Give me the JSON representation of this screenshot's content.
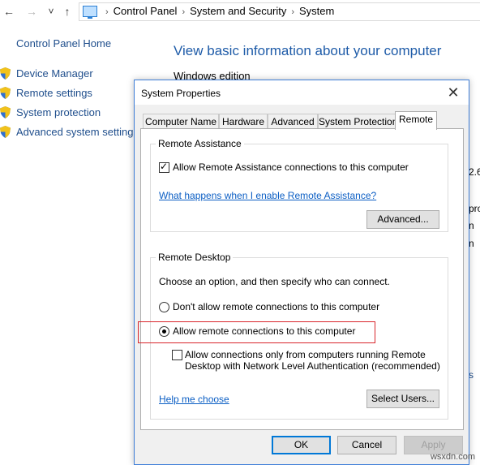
{
  "addressbar": {
    "back_glyph": "←",
    "forward_glyph": "→",
    "recent_glyph": "˅",
    "up_glyph": "↑",
    "breadcrumb": [
      "Control Panel",
      "System and Security",
      "System"
    ],
    "separator": "›"
  },
  "sidebar": {
    "home": "Control Panel Home",
    "items": [
      {
        "label": "Device Manager",
        "icon": "uac-shield-icon"
      },
      {
        "label": "Remote settings",
        "icon": "uac-shield-icon"
      },
      {
        "label": "System protection",
        "icon": "uac-shield-icon"
      },
      {
        "label": "Advanced system settings",
        "icon": "uac-shield-icon"
      }
    ]
  },
  "main": {
    "title": "View basic information about your computer",
    "windows_edition": "Windows edition",
    "fragments": [
      "2.6",
      "pro",
      "n",
      "n",
      "s"
    ]
  },
  "dialog": {
    "title": "System Properties",
    "close_glyph": "✕",
    "tabs": [
      {
        "label": "Computer Name",
        "active": false
      },
      {
        "label": "Hardware",
        "active": false
      },
      {
        "label": "Advanced",
        "active": false
      },
      {
        "label": "System Protection",
        "active": false
      },
      {
        "label": "Remote",
        "active": true
      }
    ],
    "remote_assistance": {
      "group_title": "Remote Assistance",
      "allow_label": "Allow Remote Assistance connections to this computer",
      "allow_checked": true,
      "help_link": "What happens when I enable Remote Assistance?",
      "advanced_button": "Advanced..."
    },
    "remote_desktop": {
      "group_title": "Remote Desktop",
      "instruction": "Choose an option, and then specify who can connect.",
      "options": [
        {
          "label": "Don't allow remote connections to this computer",
          "selected": false
        },
        {
          "label": "Allow remote connections to this computer",
          "selected": true
        }
      ],
      "nla_line1": "Allow connections only from computers running Remote",
      "nla_line2": "Desktop with Network Level Authentication (recommended)",
      "nla_checked": false,
      "help_link": "Help me choose",
      "select_users_button": "Select Users..."
    },
    "buttons": {
      "ok": "OK",
      "cancel": "Cancel",
      "apply": "Apply"
    }
  },
  "colors": {
    "link": "#1f4e8c",
    "title": "#1e5ba8",
    "accent": "#0078d7",
    "highlight": "#d9262c"
  },
  "watermark": "wsxdn.com"
}
